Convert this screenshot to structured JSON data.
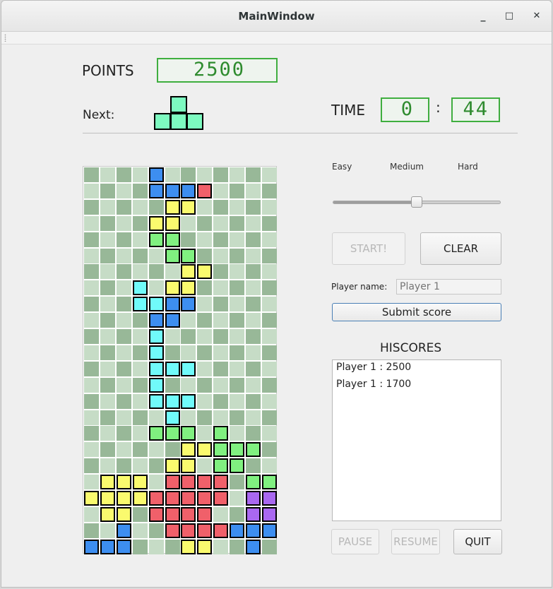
{
  "window": {
    "title": "MainWindow",
    "minimize": "_",
    "maximize": "□",
    "close": "✕"
  },
  "points": {
    "label": "POINTS",
    "value": "2500"
  },
  "next": {
    "label": "Next:"
  },
  "time": {
    "label": "TIME",
    "minutes": "0",
    "separator": ":",
    "seconds": "44"
  },
  "difficulty": {
    "easy": "Easy",
    "medium": "Medium",
    "hard": "Hard",
    "level": 0.5
  },
  "buttons": {
    "start": "START!",
    "clear": "CLEAR",
    "submit": "Submit score",
    "pause": "PAUSE",
    "resume": "RESUME",
    "quit": "QUIT"
  },
  "player": {
    "label": "Player name:",
    "placeholder": "Player 1"
  },
  "hiscores": {
    "title": "HISCORES",
    "entries": [
      "Player 1 : 2500",
      "Player 1 : 1700"
    ]
  },
  "colors": {
    "empty_light": "#c6dcc6",
    "empty_dark": "#98b898",
    "B": "#3d8ef0",
    "R": "#f0606a",
    "Y": "#fafa6e",
    "G": "#80f080",
    "C": "#70fafa",
    "P": "#a968f0",
    "M": "#7dfac0",
    "lcd": "#2e8b2e"
  },
  "next_piece": [
    "0M0",
    "MMM"
  ],
  "board": [
    "0000B00000",
    "0000BBBR00",
    "00000YY000",
    "0000YY0000",
    "0000GG0000",
    "00000GG000",
    "000000YY00",
    "000C0YY000",
    "000CCBB000",
    "0000BB0000",
    "0000C00000",
    "0000C00000",
    "0000CCC000",
    "0000C00000",
    "0000CCC000",
    "00000C0000",
    "0000GGG0G0",
    "000000YYGGG",
    "00000YY0GG0",
    "0YYY0RRRR0GG",
    "YYYYRRRRR0PP0",
    "0YY0RRRR00PPB",
    "00B00RRRRBBB",
    "BBB000YY00B00",
    "RRRR0YYBBB000"
  ]
}
